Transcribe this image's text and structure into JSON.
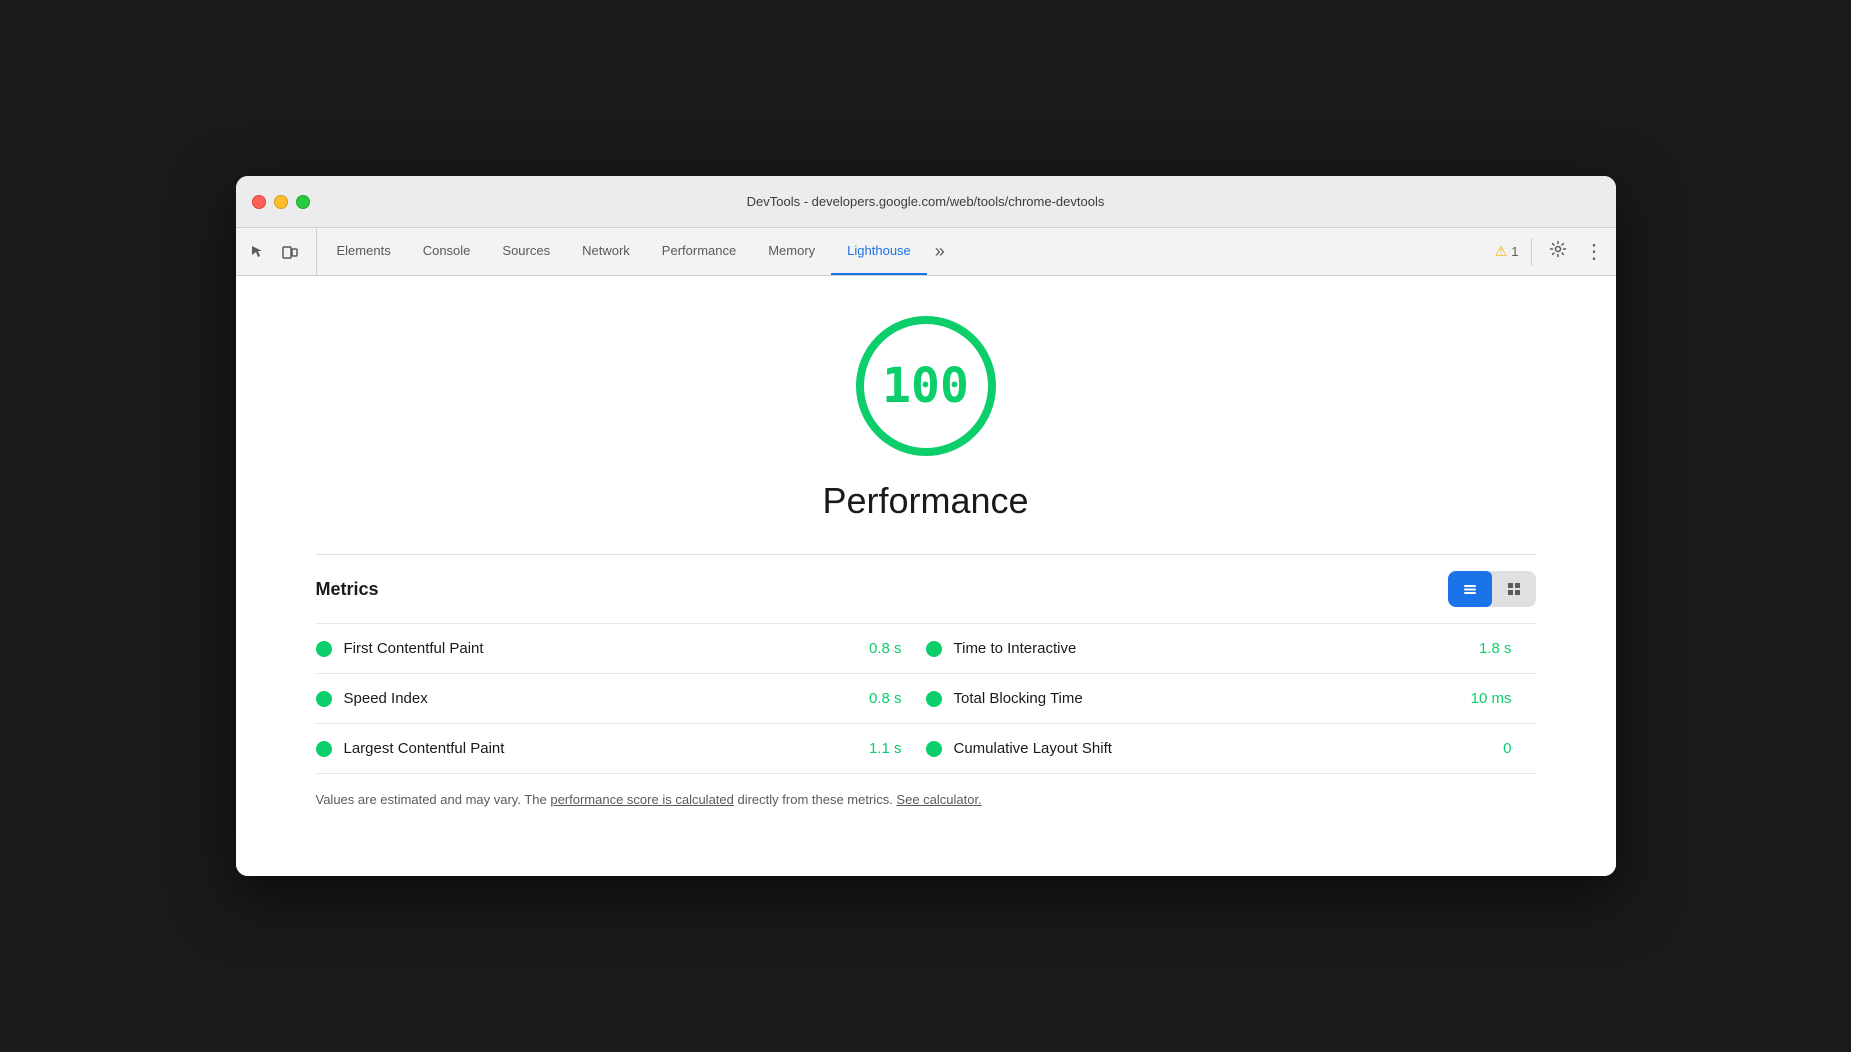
{
  "window": {
    "title": "DevTools - developers.google.com/web/tools/chrome-devtools"
  },
  "toolbar": {
    "icons": [
      {
        "name": "cursor-icon",
        "symbol": "⬚"
      },
      {
        "name": "device-toolbar-icon",
        "symbol": "▭"
      }
    ],
    "tabs": [
      {
        "id": "elements",
        "label": "Elements",
        "active": false
      },
      {
        "id": "console",
        "label": "Console",
        "active": false
      },
      {
        "id": "sources",
        "label": "Sources",
        "active": false
      },
      {
        "id": "network",
        "label": "Network",
        "active": false
      },
      {
        "id": "performance",
        "label": "Performance",
        "active": false
      },
      {
        "id": "memory",
        "label": "Memory",
        "active": false
      },
      {
        "id": "lighthouse",
        "label": "Lighthouse",
        "active": true
      }
    ],
    "more_tabs_symbol": "»",
    "warning_count": "1",
    "settings_symbol": "⚙",
    "more_options_symbol": "⋮"
  },
  "lighthouse": {
    "score": "100",
    "performance_label": "Performance",
    "metrics_label": "Metrics",
    "view_toggle": {
      "list_icon": "≡",
      "grid_icon": "≣"
    },
    "metrics": [
      {
        "name": "First Contentful Paint",
        "value": "0.8 s",
        "color": "green"
      },
      {
        "name": "Time to Interactive",
        "value": "1.8 s",
        "color": "green"
      },
      {
        "name": "Speed Index",
        "value": "0.8 s",
        "color": "green"
      },
      {
        "name": "Total Blocking Time",
        "value": "10 ms",
        "color": "green"
      },
      {
        "name": "Largest Contentful Paint",
        "value": "1.1 s",
        "color": "green"
      },
      {
        "name": "Cumulative Layout Shift",
        "value": "0",
        "color": "green"
      }
    ],
    "footer_text_before": "Values are estimated and may vary. The ",
    "footer_link1_text": "performance score is calculated",
    "footer_text_middle": " directly from these metrics. ",
    "footer_link2_text": "See calculator.",
    "footer_text_after": ""
  },
  "colors": {
    "green": "#0cce6b",
    "blue": "#1a73e8",
    "warning": "#f4b400"
  }
}
